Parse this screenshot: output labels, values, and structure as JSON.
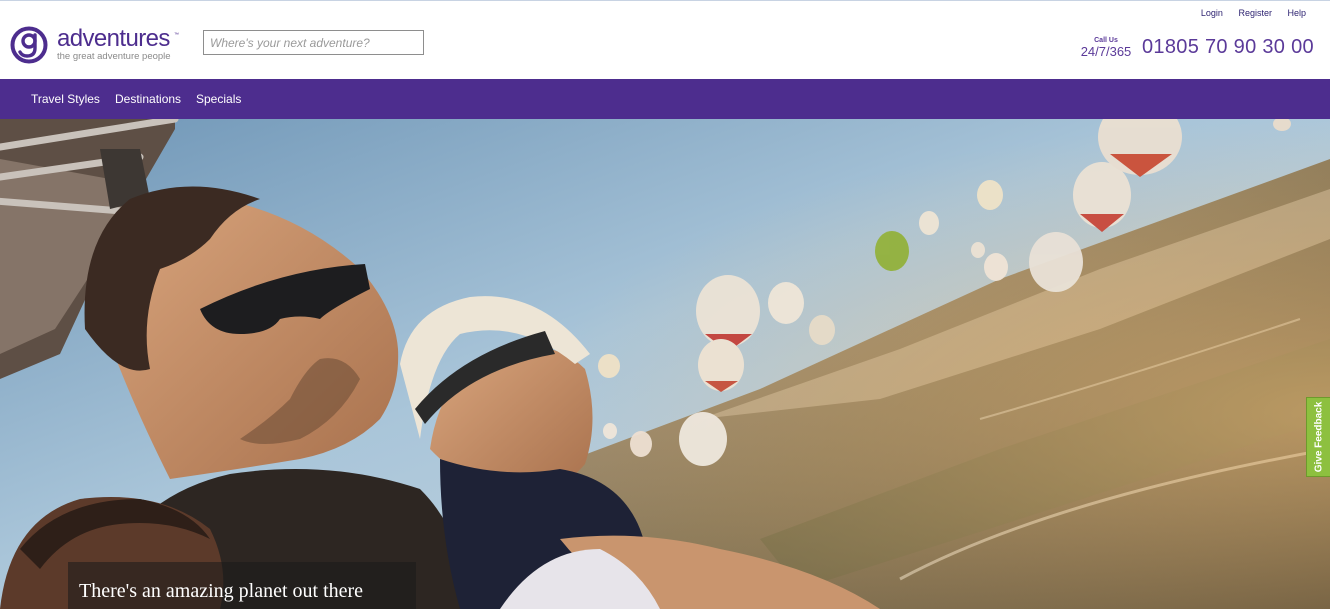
{
  "brand": {
    "name": "adventures",
    "trademark": "™",
    "tagline": "the great adventure people",
    "primary_color": "#4d2d8e"
  },
  "search": {
    "value": "",
    "placeholder": "Where's your next adventure?"
  },
  "utility_links": [
    {
      "label": "Login"
    },
    {
      "label": "Register"
    },
    {
      "label": "Help"
    }
  ],
  "contact": {
    "call_label": "Call Us",
    "hours": "24/7/365",
    "phone": "01805 70 90 30 00"
  },
  "nav": {
    "items": [
      {
        "label": "Travel Styles"
      },
      {
        "label": "Destinations"
      },
      {
        "label": "Specials"
      }
    ]
  },
  "hero": {
    "caption": "There's an amazing planet out there"
  },
  "feedback": {
    "label": "Give Feedback",
    "color": "#8dc03f"
  },
  "icons": {
    "logo": "g-logo-icon"
  }
}
